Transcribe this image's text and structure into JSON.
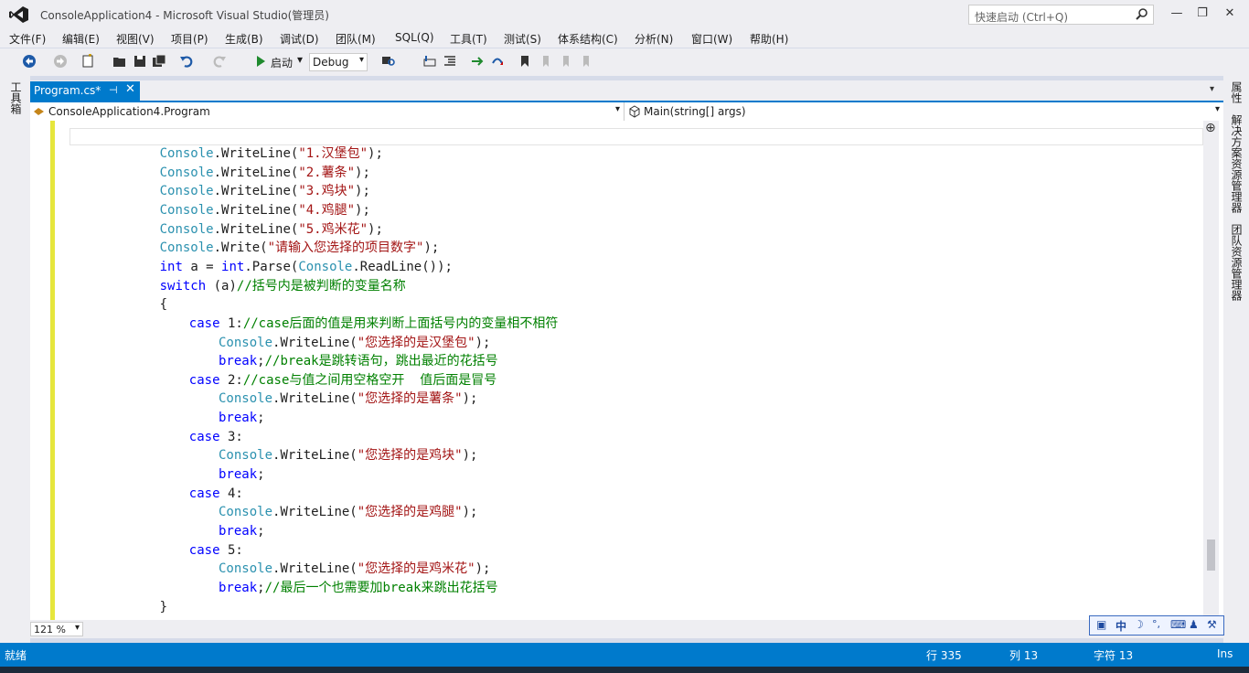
{
  "window": {
    "title": "ConsoleApplication4 - Microsoft Visual Studio(管理员)",
    "quick_launch_placeholder": "快速启动 (Ctrl+Q)",
    "minimize": "—",
    "restore": "❐",
    "close": "✕"
  },
  "menu": [
    "文件(F)",
    "编辑(E)",
    "视图(V)",
    "项目(P)",
    "生成(B)",
    "调试(D)",
    "团队(M)",
    "SQL(Q)",
    "工具(T)",
    "测试(S)",
    "体系结构(C)",
    "分析(N)",
    "窗口(W)",
    "帮助(H)"
  ],
  "toolbar": {
    "start_label": "启动",
    "config_value": "Debug"
  },
  "left_toolwindow": "工具箱",
  "right_toolwindows": [
    "属性",
    "解决方案资源管理器",
    "团队资源管理器"
  ],
  "tab": {
    "label": "Program.cs*",
    "pin": "⊣",
    "close": "✕"
  },
  "navbar": {
    "class_value": "ConsoleApplication4.Program",
    "member_value": "Main(string[] args)"
  },
  "code_lines": [
    {
      "indent": 12,
      "parts": [
        [
          "Console",
          "type"
        ],
        [
          ".WriteLine(",
          "plain"
        ],
        [
          "\"1.汉堡包\"",
          "str"
        ],
        [
          ");",
          "plain"
        ]
      ]
    },
    {
      "indent": 12,
      "parts": [
        [
          "Console",
          "type"
        ],
        [
          ".WriteLine(",
          "plain"
        ],
        [
          "\"2.薯条\"",
          "str"
        ],
        [
          ");",
          "plain"
        ]
      ]
    },
    {
      "indent": 12,
      "parts": [
        [
          "Console",
          "type"
        ],
        [
          ".WriteLine(",
          "plain"
        ],
        [
          "\"3.鸡块\"",
          "str"
        ],
        [
          ");",
          "plain"
        ]
      ]
    },
    {
      "indent": 12,
      "parts": [
        [
          "Console",
          "type"
        ],
        [
          ".WriteLine(",
          "plain"
        ],
        [
          "\"4.鸡腿\"",
          "str"
        ],
        [
          ");",
          "plain"
        ]
      ]
    },
    {
      "indent": 12,
      "parts": [
        [
          "Console",
          "type"
        ],
        [
          ".WriteLine(",
          "plain"
        ],
        [
          "\"5.鸡米花\"",
          "str"
        ],
        [
          ");",
          "plain"
        ]
      ]
    },
    {
      "indent": 12,
      "parts": [
        [
          "Console",
          "type"
        ],
        [
          ".Write(",
          "plain"
        ],
        [
          "\"请输入您选择的项目数字\"",
          "str"
        ],
        [
          ");",
          "plain"
        ]
      ]
    },
    {
      "indent": 12,
      "parts": [
        [
          "int",
          "kw"
        ],
        [
          " a = ",
          "plain"
        ],
        [
          "int",
          "kw"
        ],
        [
          ".Parse(",
          "plain"
        ],
        [
          "Console",
          "type"
        ],
        [
          ".ReadLine());",
          "plain"
        ]
      ]
    },
    {
      "indent": 12,
      "parts": [
        [
          "switch",
          "kw"
        ],
        [
          " (a)",
          "plain"
        ],
        [
          "//括号内是被判断的变量名称",
          "cmt"
        ]
      ]
    },
    {
      "indent": 12,
      "parts": [
        [
          "{",
          "plain"
        ]
      ]
    },
    {
      "indent": 16,
      "parts": [
        [
          "case",
          "kw"
        ],
        [
          " 1:",
          "plain"
        ],
        [
          "//case后面的值是用来判断上面括号内的变量相不相符",
          "cmt"
        ]
      ]
    },
    {
      "indent": 20,
      "parts": [
        [
          "Console",
          "type"
        ],
        [
          ".WriteLine(",
          "plain"
        ],
        [
          "\"您选择的是汉堡包\"",
          "str"
        ],
        [
          ");",
          "plain"
        ]
      ]
    },
    {
      "indent": 20,
      "parts": [
        [
          "break",
          "kw"
        ],
        [
          ";",
          "plain"
        ],
        [
          "//break是跳转语句，跳出最近的花括号",
          "cmt"
        ]
      ]
    },
    {
      "indent": 16,
      "parts": [
        [
          "case",
          "kw"
        ],
        [
          " 2:",
          "plain"
        ],
        [
          "//case与值之间用空格空开  值后面是冒号",
          "cmt"
        ]
      ]
    },
    {
      "indent": 20,
      "parts": [
        [
          "Console",
          "type"
        ],
        [
          ".WriteLine(",
          "plain"
        ],
        [
          "\"您选择的是薯条\"",
          "str"
        ],
        [
          ");",
          "plain"
        ]
      ]
    },
    {
      "indent": 20,
      "parts": [
        [
          "break",
          "kw"
        ],
        [
          ";",
          "plain"
        ]
      ]
    },
    {
      "indent": 16,
      "parts": [
        [
          "case",
          "kw"
        ],
        [
          " 3:",
          "plain"
        ]
      ]
    },
    {
      "indent": 20,
      "parts": [
        [
          "Console",
          "type"
        ],
        [
          ".WriteLine(",
          "plain"
        ],
        [
          "\"您选择的是鸡块\"",
          "str"
        ],
        [
          ");",
          "plain"
        ]
      ]
    },
    {
      "indent": 20,
      "parts": [
        [
          "break",
          "kw"
        ],
        [
          ";",
          "plain"
        ]
      ]
    },
    {
      "indent": 16,
      "parts": [
        [
          "case",
          "kw"
        ],
        [
          " 4:",
          "plain"
        ]
      ]
    },
    {
      "indent": 20,
      "parts": [
        [
          "Console",
          "type"
        ],
        [
          ".WriteLine(",
          "plain"
        ],
        [
          "\"您选择的是鸡腿\"",
          "str"
        ],
        [
          ");",
          "plain"
        ]
      ]
    },
    {
      "indent": 20,
      "parts": [
        [
          "break",
          "kw"
        ],
        [
          ";",
          "plain"
        ]
      ]
    },
    {
      "indent": 16,
      "parts": [
        [
          "case",
          "kw"
        ],
        [
          " 5:",
          "plain"
        ]
      ]
    },
    {
      "indent": 20,
      "parts": [
        [
          "Console",
          "type"
        ],
        [
          ".WriteLine(",
          "plain"
        ],
        [
          "\"您选择的是鸡米花\"",
          "str"
        ],
        [
          ");",
          "plain"
        ]
      ]
    },
    {
      "indent": 20,
      "parts": [
        [
          "break",
          "kw"
        ],
        [
          ";",
          "plain"
        ],
        [
          "//最后一个也需要加break来跳出花括号",
          "cmt"
        ]
      ]
    },
    {
      "indent": 12,
      "parts": [
        [
          "}",
          "plain"
        ]
      ]
    }
  ],
  "zoom": "121 %",
  "status": {
    "state": "就绪",
    "line": "行 335",
    "col": "列 13",
    "char": "字符 13",
    "mode": "Ins"
  },
  "ime": {
    "lang": "中"
  },
  "colors": {
    "accent": "#007acc",
    "keyword": "#0000ff",
    "type": "#2b91af",
    "string": "#a31515",
    "comment": "#008000",
    "margin": "#e6e63c"
  }
}
